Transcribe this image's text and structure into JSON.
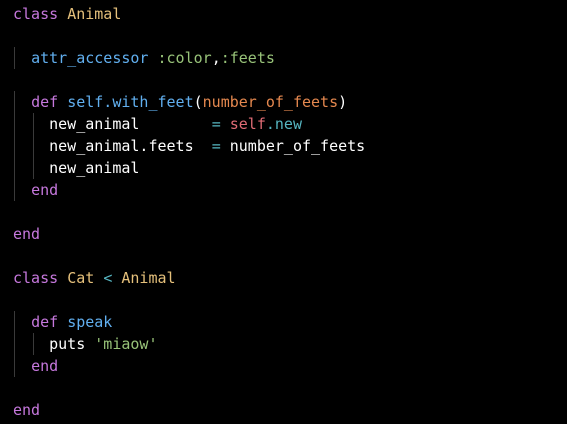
{
  "editor": {
    "lines": [
      {
        "indent": "",
        "tokens": [
          {
            "t": "kw",
            "v": "class"
          },
          {
            "t": "txt",
            "v": " "
          },
          {
            "t": "cls",
            "v": "Animal"
          }
        ]
      },
      {
        "indent": "",
        "tokens": []
      },
      {
        "indent": "  ",
        "tokens": [
          {
            "t": "fn",
            "v": "attr_accessor"
          },
          {
            "t": "txt",
            "v": " "
          },
          {
            "t": "sym",
            "v": ":color"
          },
          {
            "t": "txt",
            "v": ","
          },
          {
            "t": "sym",
            "v": ":feets"
          }
        ]
      },
      {
        "indent": "",
        "tokens": []
      },
      {
        "indent": "  ",
        "tokens": [
          {
            "t": "kw",
            "v": "def"
          },
          {
            "t": "txt",
            "v": " "
          },
          {
            "t": "fn",
            "v": "self.with_feet"
          },
          {
            "t": "txt",
            "v": "("
          },
          {
            "t": "par",
            "v": "number_of_feets"
          },
          {
            "t": "txt",
            "v": ")"
          }
        ]
      },
      {
        "indent": "    ",
        "tokens": [
          {
            "t": "txt",
            "v": "new_animal        "
          },
          {
            "t": "op",
            "v": "="
          },
          {
            "t": "txt",
            "v": " "
          },
          {
            "t": "self",
            "v": "self"
          },
          {
            "t": "op",
            "v": ".new"
          }
        ]
      },
      {
        "indent": "    ",
        "tokens": [
          {
            "t": "txt",
            "v": "new_animal.feets  "
          },
          {
            "t": "op",
            "v": "="
          },
          {
            "t": "txt",
            "v": " number_of_feets"
          }
        ]
      },
      {
        "indent": "    ",
        "tokens": [
          {
            "t": "txt",
            "v": "new_animal"
          }
        ]
      },
      {
        "indent": "  ",
        "tokens": [
          {
            "t": "kw",
            "v": "end"
          }
        ]
      },
      {
        "indent": "",
        "tokens": []
      },
      {
        "indent": "",
        "tokens": [
          {
            "t": "kw",
            "v": "end"
          }
        ]
      },
      {
        "indent": "",
        "tokens": []
      },
      {
        "indent": "",
        "tokens": [
          {
            "t": "kw",
            "v": "class"
          },
          {
            "t": "txt",
            "v": " "
          },
          {
            "t": "cls",
            "v": "Cat"
          },
          {
            "t": "txt",
            "v": " "
          },
          {
            "t": "op",
            "v": "<"
          },
          {
            "t": "txt",
            "v": " "
          },
          {
            "t": "cls",
            "v": "Animal"
          }
        ]
      },
      {
        "indent": "",
        "tokens": []
      },
      {
        "indent": "  ",
        "tokens": [
          {
            "t": "kw",
            "v": "def"
          },
          {
            "t": "txt",
            "v": " "
          },
          {
            "t": "fn",
            "v": "speak"
          }
        ]
      },
      {
        "indent": "    ",
        "tokens": [
          {
            "t": "txt",
            "v": "puts "
          },
          {
            "t": "str",
            "v": "'miaow'"
          }
        ]
      },
      {
        "indent": "  ",
        "tokens": [
          {
            "t": "kw",
            "v": "end"
          }
        ]
      },
      {
        "indent": "",
        "tokens": []
      },
      {
        "indent": "",
        "tokens": [
          {
            "t": "kw",
            "v": "end"
          }
        ]
      }
    ]
  },
  "colors": {
    "background": "#000000",
    "keyword": "#c678dd",
    "class_name": "#e5c07b",
    "function": "#61afef",
    "symbol": "#98c379",
    "parameter": "#e5884f",
    "operator": "#56b6c2",
    "self": "#e06c75",
    "string": "#98c379",
    "text": "#ffffff"
  }
}
